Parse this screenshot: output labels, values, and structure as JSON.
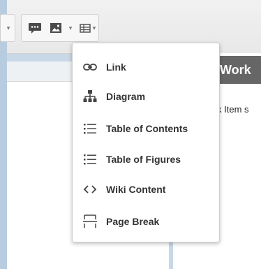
{
  "menu": {
    "items": [
      {
        "icon": "link-icon",
        "label": "Link"
      },
      {
        "icon": "diagram-icon",
        "label": "Diagram"
      },
      {
        "icon": "list-icon",
        "label": "Table of Contents"
      },
      {
        "icon": "list-icon",
        "label": "Table of Figures"
      },
      {
        "icon": "code-icon",
        "label": "Wiki Content"
      },
      {
        "icon": "page-break-icon",
        "label": "Page Break"
      }
    ]
  },
  "document": {
    "heading": "Work",
    "body_text": "k Item s"
  },
  "colors": {
    "heading_bg": "#666666",
    "menu_text": "#333333",
    "page_bg": "#c9d8e6"
  }
}
